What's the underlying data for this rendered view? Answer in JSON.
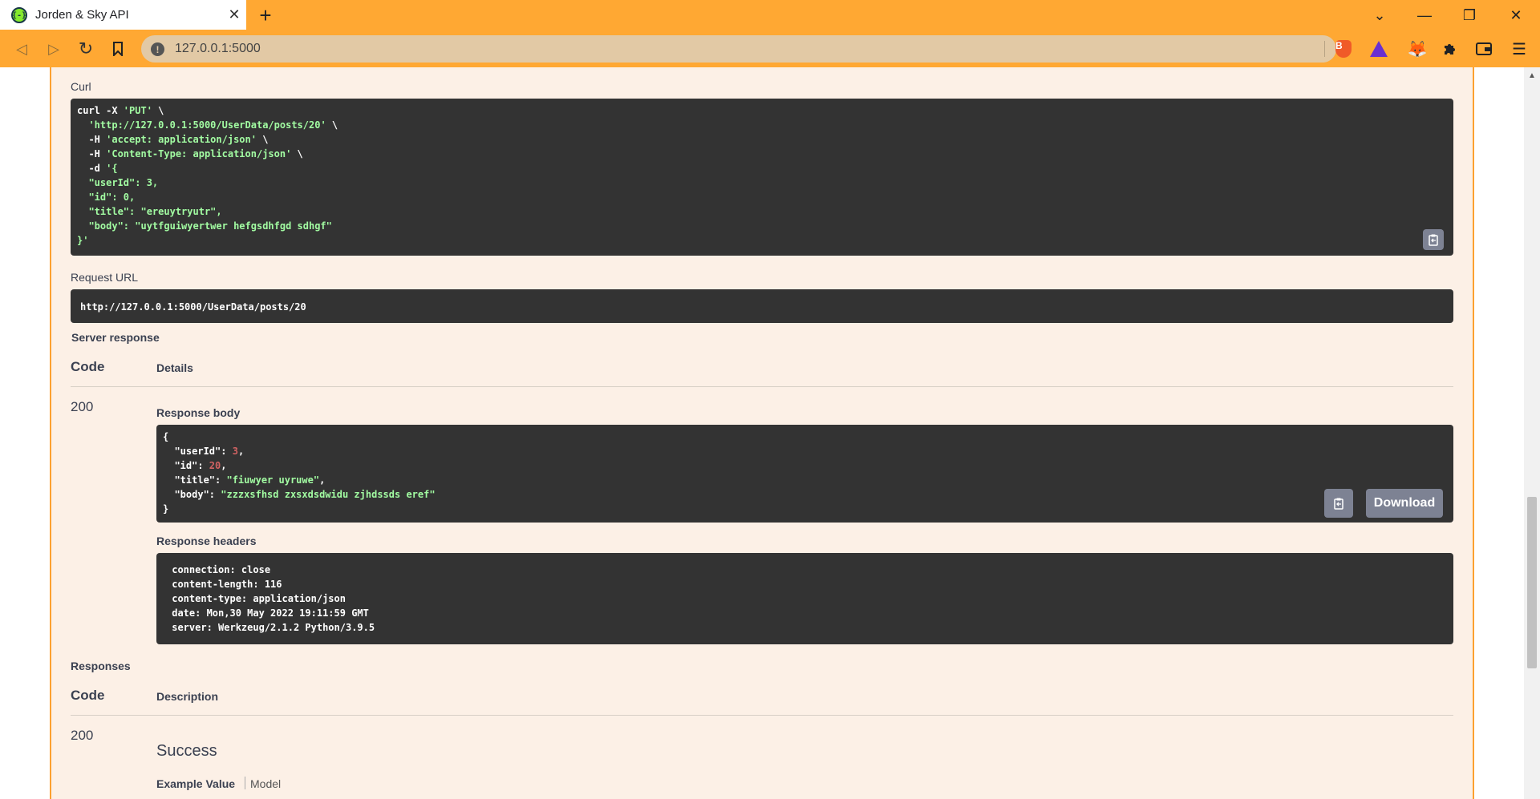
{
  "browser": {
    "tab_title": "Jorden & Sky API",
    "tab_close": "✕",
    "new_tab": "+",
    "url": "127.0.0.1:5000",
    "controls": {
      "tabs_menu": "⌄",
      "minimize": "—",
      "restore": "❐",
      "close": "✕"
    },
    "nav": {
      "back": "◁",
      "forward": "▷",
      "reload": "↻",
      "bookmark": "🔖"
    }
  },
  "curl": {
    "label": "Curl",
    "lines": [
      {
        "a": "curl -X ",
        "s": "'PUT'",
        "b": " \\"
      },
      {
        "a": "  ",
        "s": "'http://127.0.0.1:5000/UserData/posts/20'",
        "b": " \\"
      },
      {
        "a": "  -H ",
        "s": "'accept: application/json'",
        "b": " \\"
      },
      {
        "a": "  -H ",
        "s": "'Content-Type: application/json'",
        "b": " \\"
      },
      {
        "a": "  -d ",
        "s": "'{",
        "b": ""
      },
      {
        "a": "",
        "s": "  \"userId\": 3,",
        "b": ""
      },
      {
        "a": "",
        "s": "  \"id\": 0,",
        "b": ""
      },
      {
        "a": "",
        "s": "  \"title\": \"ereuytryutr\",",
        "b": ""
      },
      {
        "a": "",
        "s": "  \"body\": \"uytfguiwyertwer hefgsdhfgd sdhgf\"",
        "b": ""
      },
      {
        "a": "",
        "s": "}'",
        "b": ""
      }
    ]
  },
  "request_url": {
    "label": "Request URL",
    "value": "http://127.0.0.1:5000/UserData/posts/20"
  },
  "server_response": {
    "label": "Server response",
    "code_header": "Code",
    "details_header": "Details",
    "code": "200",
    "response_body_label": "Response body",
    "body": {
      "open": "{",
      "fields": [
        {
          "key": "  \"userId\": ",
          "value": "3",
          "type": "num",
          "tail": ","
        },
        {
          "key": "  \"id\": ",
          "value": "20",
          "type": "num",
          "tail": ","
        },
        {
          "key": "  \"title\": ",
          "value": "\"fiuwyer uyruwe\"",
          "type": "str",
          "tail": ","
        },
        {
          "key": "  \"body\": ",
          "value": "\"zzzxsfhsd zxsxdsdwidu zjhdssds eref\"",
          "type": "str",
          "tail": ""
        }
      ],
      "close": "}"
    },
    "download_label": "Download",
    "response_headers_label": "Response headers",
    "headers": [
      " connection: close ",
      " content-length: 116 ",
      " content-type: application/json ",
      " date: Mon,30 May 2022 19:11:59 GMT ",
      " server: Werkzeug/2.1.2 Python/3.9.5 "
    ]
  },
  "responses": {
    "label": "Responses",
    "code_header": "Code",
    "description_header": "Description",
    "code": "200",
    "description": "Success",
    "example_value_tab": "Example Value",
    "model_tab": "Model"
  }
}
